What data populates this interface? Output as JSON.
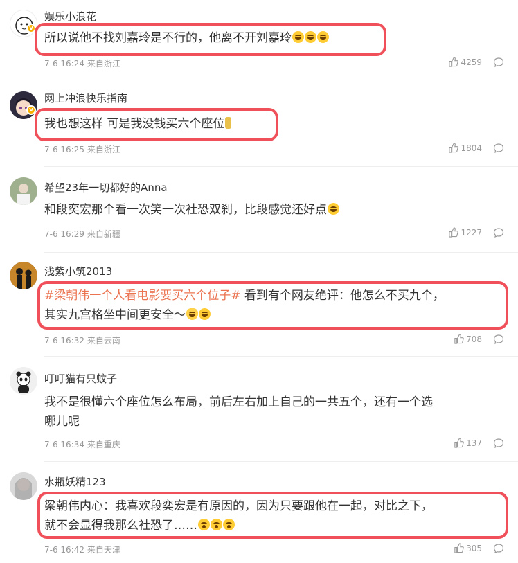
{
  "comments": [
    {
      "username": "娱乐小浪花",
      "text": "所以说他不找刘嘉玲是不行的，他离不开刘嘉玲",
      "emojis": [
        "laugh-cry-emoji",
        "laugh-cry-emoji",
        "laugh-cry-emoji"
      ],
      "time": "7-6 16:24",
      "location": "来自浙江",
      "likes": "4259",
      "verified": true,
      "highlighted": true
    },
    {
      "username": "网上冲浪快乐指南",
      "text": "我也想这样 可是我没钱买六个座位",
      "emojis": [
        "bottle-emoji"
      ],
      "time": "7-6 16:25",
      "location": "来自浙江",
      "likes": "1804",
      "verified": true,
      "highlighted": true
    },
    {
      "username": "希望23年一切都好的Anna",
      "text": "和段奕宏那个看一次笑一次社恐双刹，比段感觉还好点",
      "emojis": [
        "laugh-cry-emoji"
      ],
      "time": "7-6 16:29",
      "location": "来自新疆",
      "likes": "1227",
      "verified": false,
      "highlighted": false
    },
    {
      "username": "浅紫小筑2013",
      "tag": "#梁朝伟一个人看电影要买六个位子#",
      "text_line1": " 看到有个网友绝评：他怎么不买九个，",
      "text_line2": "其实九宫格坐中间更安全～",
      "emojis": [
        "cat-emoji",
        "laugh-emoji"
      ],
      "time": "7-6 16:32",
      "location": "来自云南",
      "likes": "708",
      "verified": false,
      "highlighted": true
    },
    {
      "username": "叮叮猫有只蚊子",
      "text_line1": "我不是很懂六个座位怎么布局，前后左右加上自己的一共五个，还有一个选",
      "text_line2": "哪儿呢",
      "time": "7-6 16:34",
      "location": "来自重庆",
      "likes": "137",
      "verified": false,
      "highlighted": false
    },
    {
      "username": "水瓶妖精123",
      "text_line1": "梁朝伟内心：我喜欢段奕宏是有原因的，因为只要跟他在一起，对比之下，",
      "text_line2": "就不会显得我那么社恐了……",
      "emojis": [
        "wow-emoji",
        "wow-emoji",
        "wow-emoji"
      ],
      "time": "7-6 16:42",
      "location": "来自天津",
      "likes": "305",
      "verified": false,
      "highlighted": true
    }
  ],
  "colors": {
    "highlight": "#f0505a",
    "tag": "#eb7350",
    "meta": "#999999",
    "verified": "#f5b000"
  },
  "icons": {
    "like": "thumbs-up-icon",
    "reply": "comment-bubble-icon"
  }
}
